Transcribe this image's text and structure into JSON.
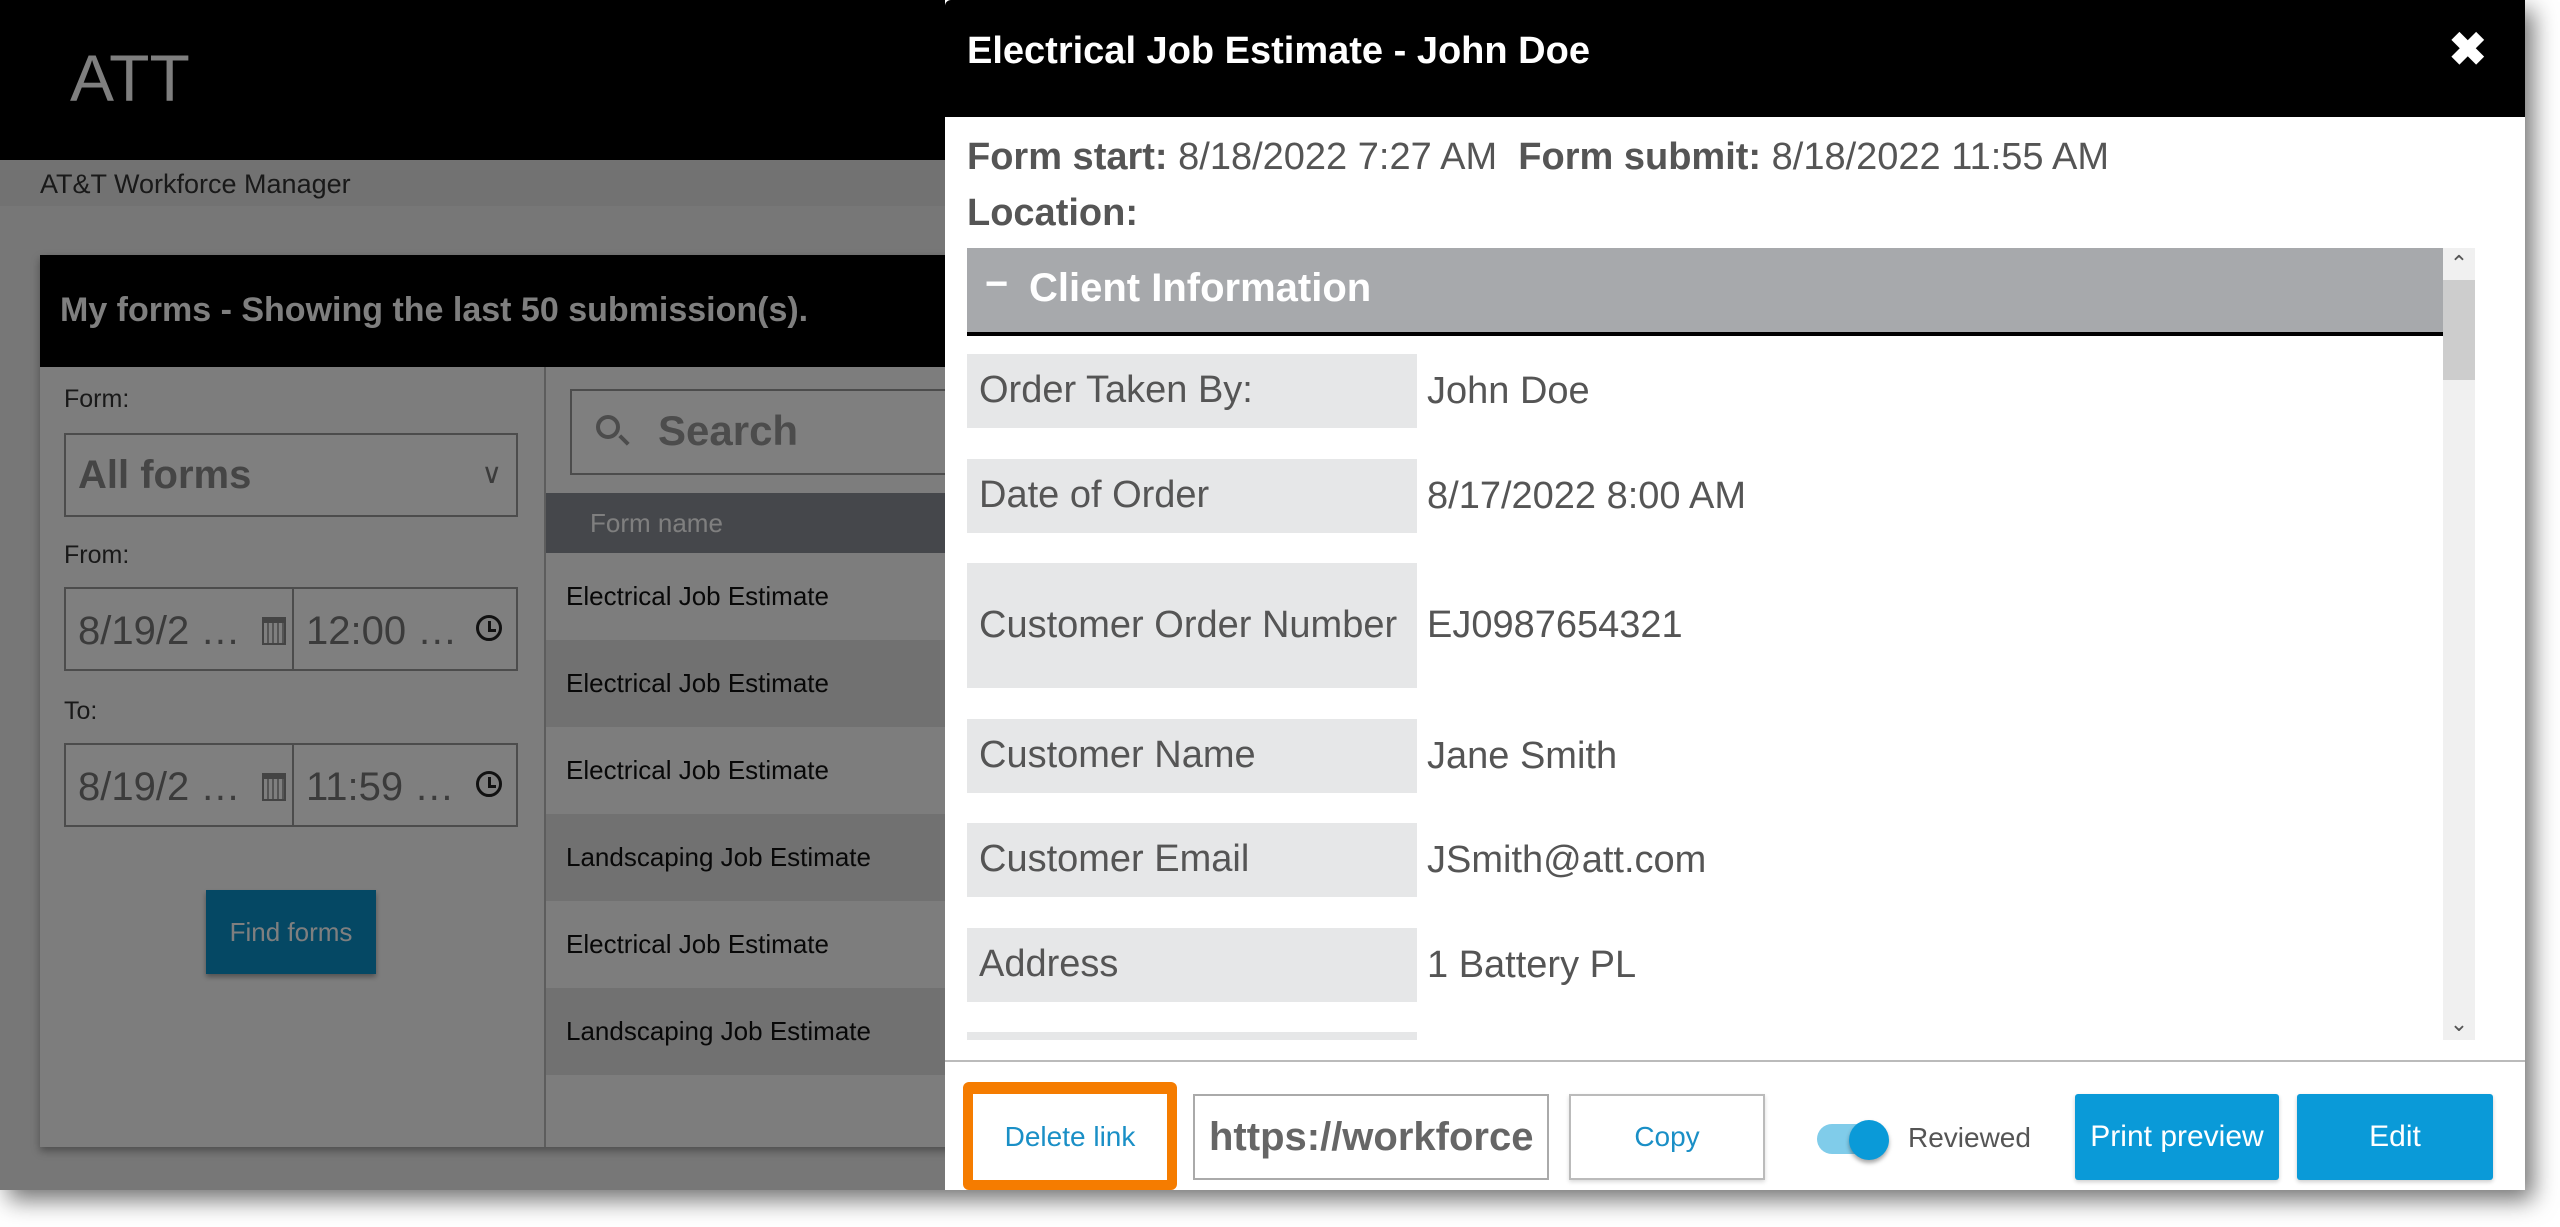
{
  "app": {
    "logo": "ATT",
    "subtitle": "AT&T Workforce Manager"
  },
  "forms_panel": {
    "title": "My forms - Showing the last 50 submission(s).",
    "filters": {
      "form_label": "Form:",
      "form_value": "All forms",
      "from_label": "From:",
      "from_date": "8/19/2 …",
      "from_time": "12:00 …",
      "to_label": "To:",
      "to_date": "8/19/2 …",
      "to_time": "11:59 …",
      "find_button": "Find forms"
    },
    "search_placeholder": "Search",
    "list_header": "Form name",
    "rows": [
      "Electrical Job Estimate",
      "Electrical Job Estimate",
      "Electrical Job Estimate",
      "Landscaping Job Estimate",
      "Electrical Job Estimate",
      "Landscaping Job Estimate"
    ]
  },
  "dialog": {
    "title": "Electrical Job Estimate - John Doe",
    "close_icon": "✖",
    "form_start_label": "Form start:",
    "form_start_value": "8/18/2022 7:27 AM",
    "form_submit_label": "Form submit:",
    "form_submit_value": "8/18/2022 11:55 AM",
    "location_label": "Location:",
    "location_value": "",
    "section": {
      "toggle": "−",
      "title": "Client Information"
    },
    "fields": [
      {
        "label": "Order Taken By:",
        "value": "John Doe"
      },
      {
        "label": "Date of Order",
        "value": "8/17/2022 8:00 AM"
      },
      {
        "label": "Customer Order Number",
        "value": "EJ0987654321"
      },
      {
        "label": "Customer Name",
        "value": "Jane Smith"
      },
      {
        "label": "Customer Email",
        "value": "JSmith@att.com"
      },
      {
        "label": "Address",
        "value": "1 Battery PL"
      }
    ],
    "footer": {
      "delete_link": "Delete link",
      "link_value": "https://workforce",
      "copy": "Copy",
      "reviewed_label": "Reviewed",
      "reviewed_on": true,
      "print_preview": "Print preview",
      "edit": "Edit"
    }
  },
  "colors": {
    "accent": "#0a9ad8",
    "highlight": "#f57c00",
    "section_header": "#a7a9ac"
  }
}
